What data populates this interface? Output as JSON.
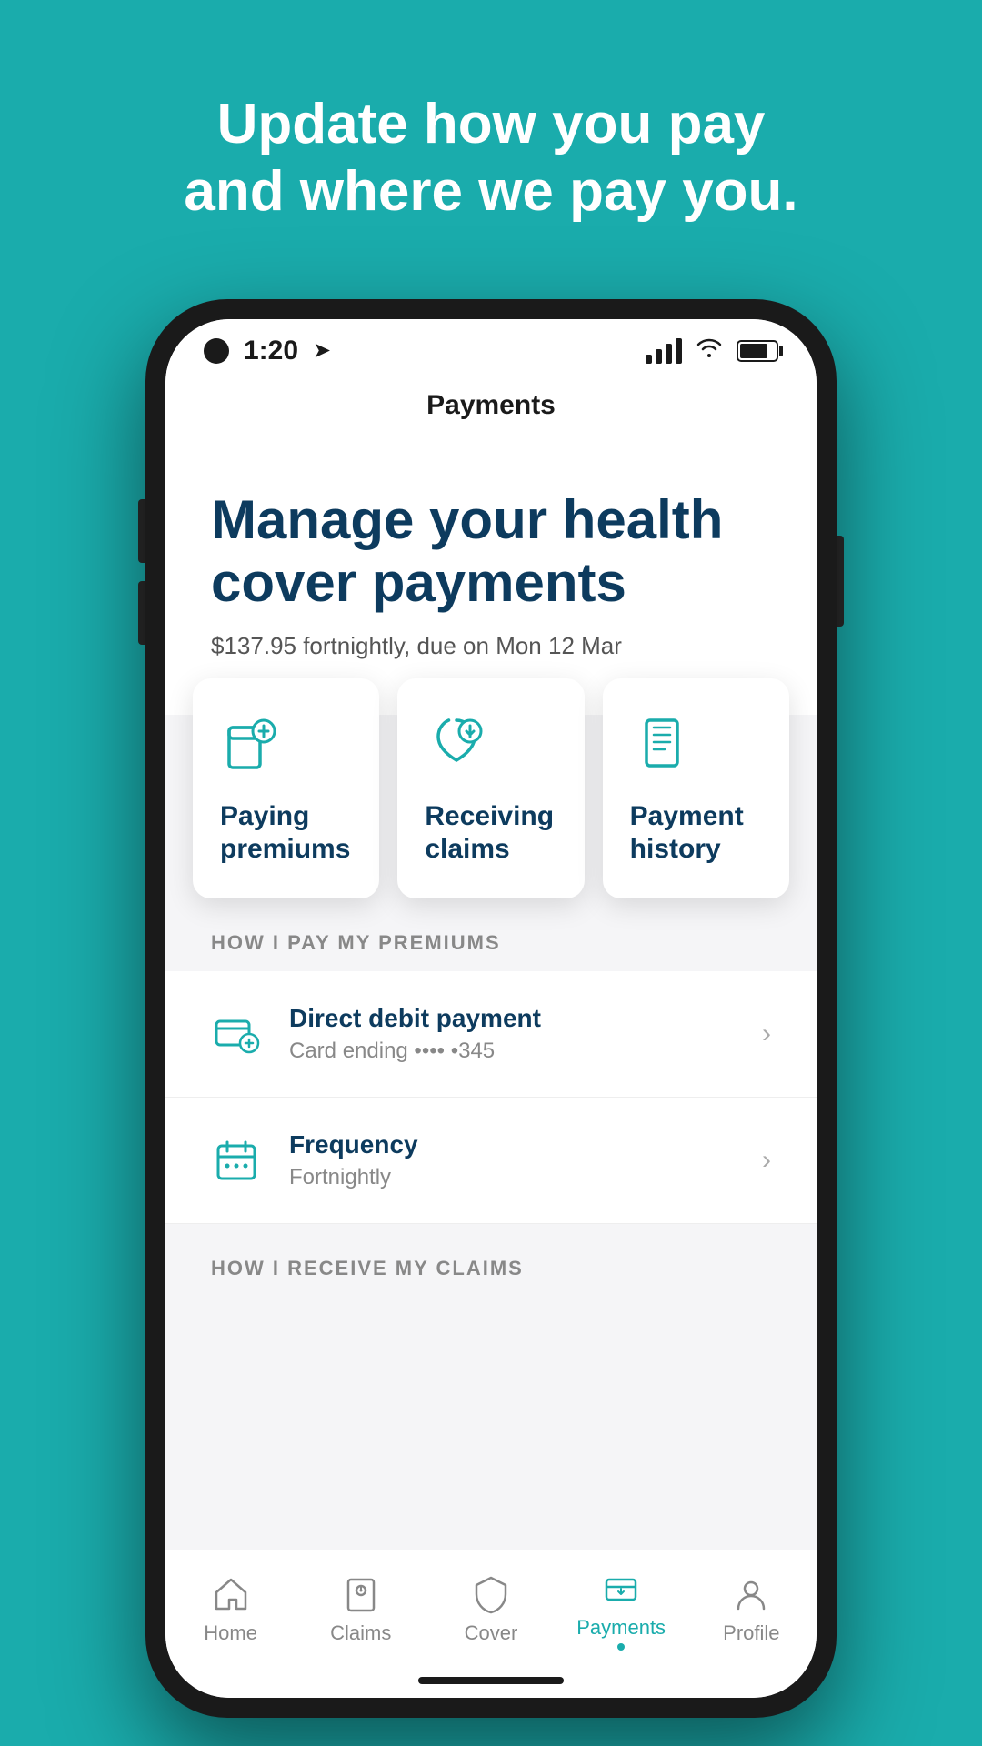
{
  "hero": {
    "title": "Update how you pay",
    "title2": "and where we pay you."
  },
  "status_bar": {
    "time": "1:20",
    "show_arrow": true
  },
  "page_title": "Payments",
  "manage_section": {
    "heading_line1": "Manage your health",
    "heading_line2": "cover payments",
    "payment_info": "$137.95 fortnightly, due on Mon 12 Mar"
  },
  "cards": [
    {
      "id": "paying-premiums",
      "label_line1": "Paying",
      "label_line2": "premiums"
    },
    {
      "id": "receiving-claims",
      "label_line1": "Receiving",
      "label_line2": "claims"
    },
    {
      "id": "payment-history",
      "label_line1": "Payment",
      "label_line2": "history"
    }
  ],
  "premiums_section": {
    "header": "HOW I PAY MY PREMIUMS",
    "items": [
      {
        "title": "Direct debit payment",
        "subtitle": "Card ending •••• •345"
      },
      {
        "title": "Frequency",
        "subtitle": "Fortnightly"
      }
    ]
  },
  "claims_section": {
    "header": "HOW I RECEIVE MY CLAIMS"
  },
  "nav": {
    "items": [
      {
        "label": "Home",
        "active": false
      },
      {
        "label": "Claims",
        "active": false
      },
      {
        "label": "Cover",
        "active": false
      },
      {
        "label": "Payments",
        "active": true
      },
      {
        "label": "Profile",
        "active": false
      }
    ]
  },
  "colors": {
    "teal": "#1AACAC",
    "dark_blue": "#0d3b5e",
    "white": "#ffffff"
  }
}
